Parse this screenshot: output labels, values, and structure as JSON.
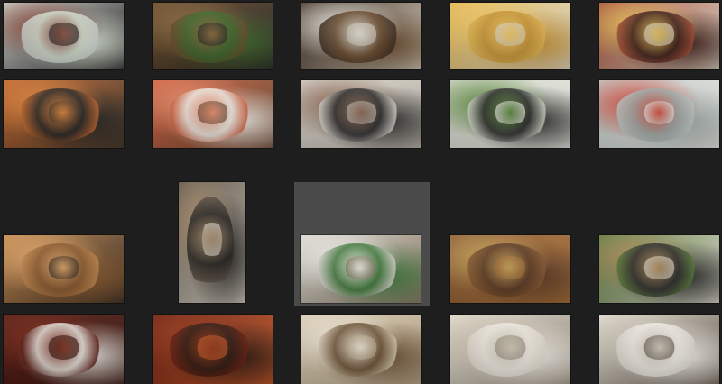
{
  "gallery": {
    "selected_index": 12,
    "rows": [
      [
        {
          "name": "photo-spring-rolls",
          "colors": [
            "#cfd3cf",
            "#8a4b3c",
            "#d7e2d3",
            "#2c2b2a"
          ]
        },
        {
          "name": "photo-fried-meat",
          "colors": [
            "#6b4b2a",
            "#8c6a40",
            "#3f6b2d",
            "#2b2a27"
          ]
        },
        {
          "name": "photo-onion-beef-soup",
          "colors": [
            "#3b2a1e",
            "#e6e4dc",
            "#6a4a2d",
            "#cfc7b6"
          ]
        },
        {
          "name": "photo-yellow-noodles",
          "colors": [
            "#e2b650",
            "#f0c867",
            "#c79333",
            "#dcd6c8"
          ]
        },
        {
          "name": "photo-noodle-bowls",
          "colors": [
            "#a44b35",
            "#e9c25a",
            "#3b1d17",
            "#d9d2c3"
          ]
        }
      ],
      [
        {
          "name": "photo-seafood-pancake",
          "colors": [
            "#c0662e",
            "#e0853c",
            "#262626",
            "#4a3b2c"
          ]
        },
        {
          "name": "photo-kimchi",
          "colors": [
            "#d0603e",
            "#e88b6a",
            "#f2f0ea",
            "#6b4b36"
          ]
        },
        {
          "name": "photo-beef-bone-soup",
          "colors": [
            "#d6d2ca",
            "#8d6a55",
            "#2d2d2d",
            "#bdb6ab"
          ]
        },
        {
          "name": "photo-scallion-soup",
          "colors": [
            "#cfd3c6",
            "#5b8a3b",
            "#2b2b2b",
            "#e6e6e0"
          ]
        },
        {
          "name": "photo-cold-noodles",
          "colors": [
            "#bfc7c4",
            "#d24a3b",
            "#9fa9a6",
            "#e3e4e0"
          ]
        }
      ],
      [
        {
          "name": "photo-fried-chicken",
          "colors": [
            "#c58a4f",
            "#e0a66a",
            "#8a5a30",
            "#3a2e24"
          ]
        },
        {
          "name": "photo-grilled-mackerel",
          "colors": [
            "#5b4f42",
            "#a88d6c",
            "#262422",
            "#d5cfc4"
          ]
        },
        {
          "name": "photo-rice-soup",
          "colors": [
            "#d9d6cf",
            "#f0eee8",
            "#3f7a3a",
            "#8a7a66"
          ]
        },
        {
          "name": "photo-side-dishes",
          "colors": [
            "#8a5a33",
            "#c9a55a",
            "#5b3a25",
            "#a8703a"
          ]
        },
        {
          "name": "photo-soba-noodles",
          "colors": [
            "#5a7a3a",
            "#b08b5a",
            "#2a2a2a",
            "#dad6cc"
          ]
        }
      ],
      [
        {
          "name": "photo-braised-fish",
          "colors": [
            "#5a1a12",
            "#7a2a18",
            "#e9e6e0",
            "#3a1b14"
          ]
        },
        {
          "name": "photo-spicy-stew",
          "colors": [
            "#6b1f12",
            "#9a3a1a",
            "#2c1a12",
            "#c0582a"
          ]
        },
        {
          "name": "photo-dumpling-soup",
          "colors": [
            "#d6c8b0",
            "#efe7d7",
            "#6a4e32",
            "#b8a78a"
          ]
        },
        {
          "name": "photo-steamed-buns",
          "colors": [
            "#e3dccf",
            "#cfc5b3",
            "#f2eee6",
            "#9c9283"
          ]
        },
        {
          "name": "photo-noodle-chopsticks",
          "colors": [
            "#e2ddd3",
            "#cfc7b8",
            "#f3f0ea",
            "#6c6256"
          ]
        }
      ]
    ]
  }
}
